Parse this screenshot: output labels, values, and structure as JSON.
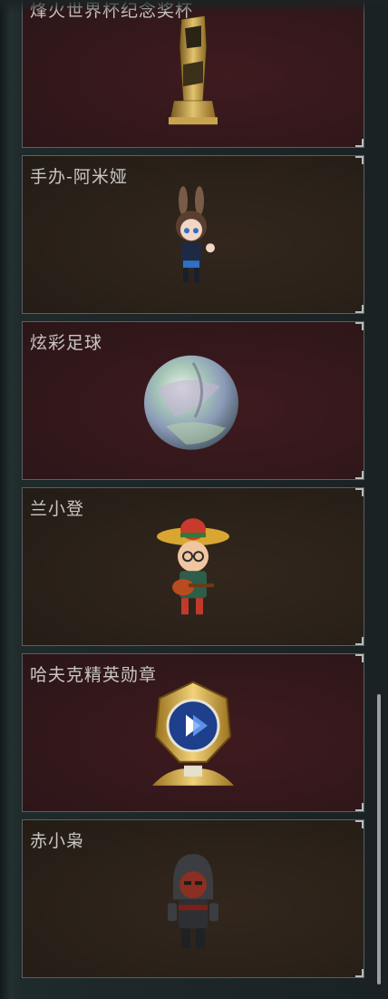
{
  "items": [
    {
      "title": "烽火世界杯纪念奖杯",
      "icon": "trophy-icon",
      "tone": "red"
    },
    {
      "title": "手办-阿米娅",
      "icon": "amiya-figure-icon",
      "tone": "brown"
    },
    {
      "title": "炫彩足球",
      "icon": "iridescent-ball-icon",
      "tone": "red"
    },
    {
      "title": "兰小登",
      "icon": "sombrero-figure-icon",
      "tone": "brown"
    },
    {
      "title": "哈夫克精英勋章",
      "icon": "elite-medal-icon",
      "tone": "red"
    },
    {
      "title": "赤小枭",
      "icon": "hooded-figure-icon",
      "tone": "brown"
    }
  ]
}
